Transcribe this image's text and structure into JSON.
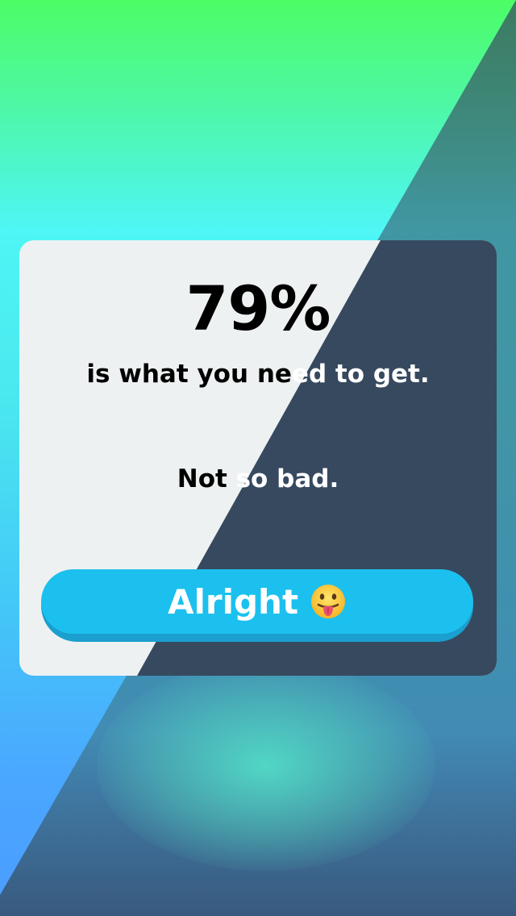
{
  "result": {
    "percent": "79%",
    "subtitle_dark": "is what you ne",
    "subtitle_light": "ed to get.",
    "remark_dark": "Not ",
    "remark_light": "so bad."
  },
  "action": {
    "button_label": "Alright",
    "button_icon": "tongue-out-emoji-icon"
  },
  "colors": {
    "card_light": "#eef1f2",
    "card_dark": "#36495f",
    "button": "#1cc0ee"
  }
}
